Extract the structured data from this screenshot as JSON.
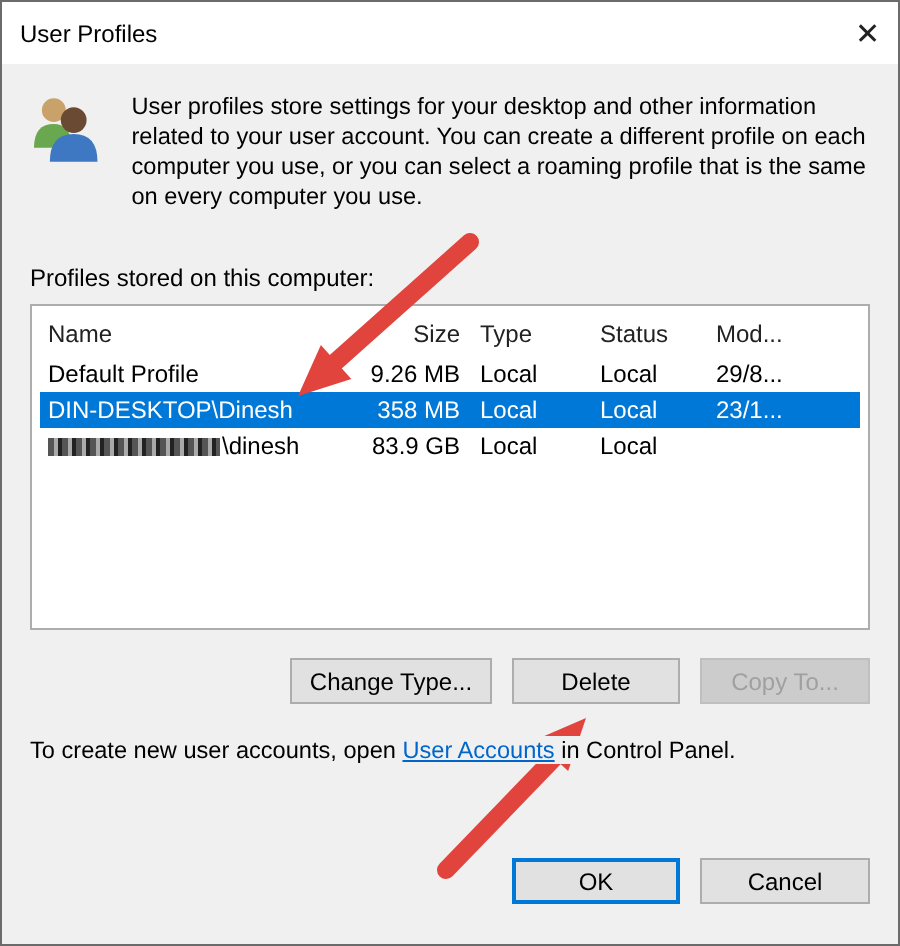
{
  "window": {
    "title": "User Profiles",
    "close": "✕"
  },
  "intro": "User profiles store settings for your desktop and other information related to your user account. You can create a different profile on each computer you use, or you can select a roaming profile that is the same on every computer you use.",
  "profiles_label": "Profiles stored on this computer:",
  "table": {
    "columns": [
      "Name",
      "Size",
      "Type",
      "Status",
      "Mod..."
    ],
    "rows": [
      {
        "cells": [
          "Default Profile",
          "9.26 MB",
          "Local",
          "Local",
          "29/8..."
        ],
        "selected": false,
        "redacted": false
      },
      {
        "cells": [
          "DIN-DESKTOP\\Dinesh",
          "358 MB",
          "Local",
          "Local",
          "23/1..."
        ],
        "selected": true,
        "redacted": false
      },
      {
        "cells": [
          "\\dinesh",
          "83.9 GB",
          "Local",
          "Local",
          ""
        ],
        "selected": false,
        "redacted": true
      }
    ]
  },
  "actions": [
    {
      "label": "Change Type...",
      "disabled": false
    },
    {
      "label": "Delete",
      "disabled": false
    },
    {
      "label": "Copy To...",
      "disabled": true
    }
  ],
  "footer": {
    "before": "To create new user accounts, open ",
    "link": "User Accounts",
    "after": " in Control Panel."
  },
  "buttons": [
    {
      "label": "OK",
      "default": true
    },
    {
      "label": "Cancel",
      "default": false
    }
  ],
  "annotations": [
    {
      "kind": "arrow"
    },
    {
      "kind": "arrow"
    }
  ]
}
